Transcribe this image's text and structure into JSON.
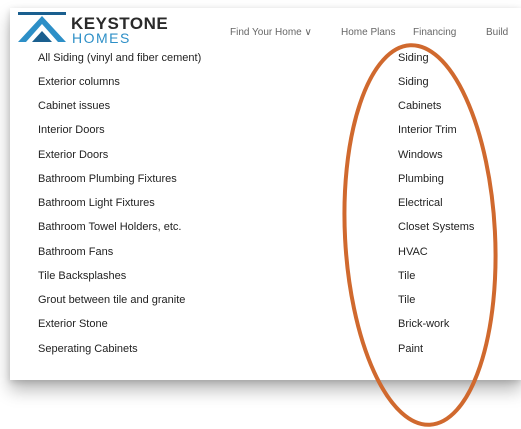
{
  "header": {
    "logo_top": "KEYSTONE",
    "logo_bottom": "HOMES",
    "nav": [
      "Find Your Home ∨",
      "Home Plans",
      "Financing",
      "Build"
    ]
  },
  "rows": [
    {
      "item": "All Siding (vinyl and fiber cement)",
      "category": "Siding"
    },
    {
      "item": "Exterior columns",
      "category": "Siding"
    },
    {
      "item": "Cabinet issues",
      "category": "Cabinets"
    },
    {
      "item": "Interior Doors",
      "category": "Interior Trim"
    },
    {
      "item": "Exterior Doors",
      "category": "Windows"
    },
    {
      "item": "Bathroom Plumbing Fixtures",
      "category": "Plumbing"
    },
    {
      "item": "Bathroom Light Fixtures",
      "category": "Electrical"
    },
    {
      "item": "Bathroom Towel Holders, etc.",
      "category": "Closet Systems"
    },
    {
      "item": "Bathroom Fans",
      "category": "HVAC"
    },
    {
      "item": "Tile Backsplashes",
      "category": "Tile"
    },
    {
      "item": "Grout between tile and granite",
      "category": "Tile"
    },
    {
      "item": "Exterior Stone",
      "category": "Brick-work"
    },
    {
      "item": "Seperating Cabinets",
      "category": "Paint"
    }
  ],
  "colors": {
    "brand_blue": "#2d8fc7",
    "annotation_orange": "#d0692e"
  }
}
